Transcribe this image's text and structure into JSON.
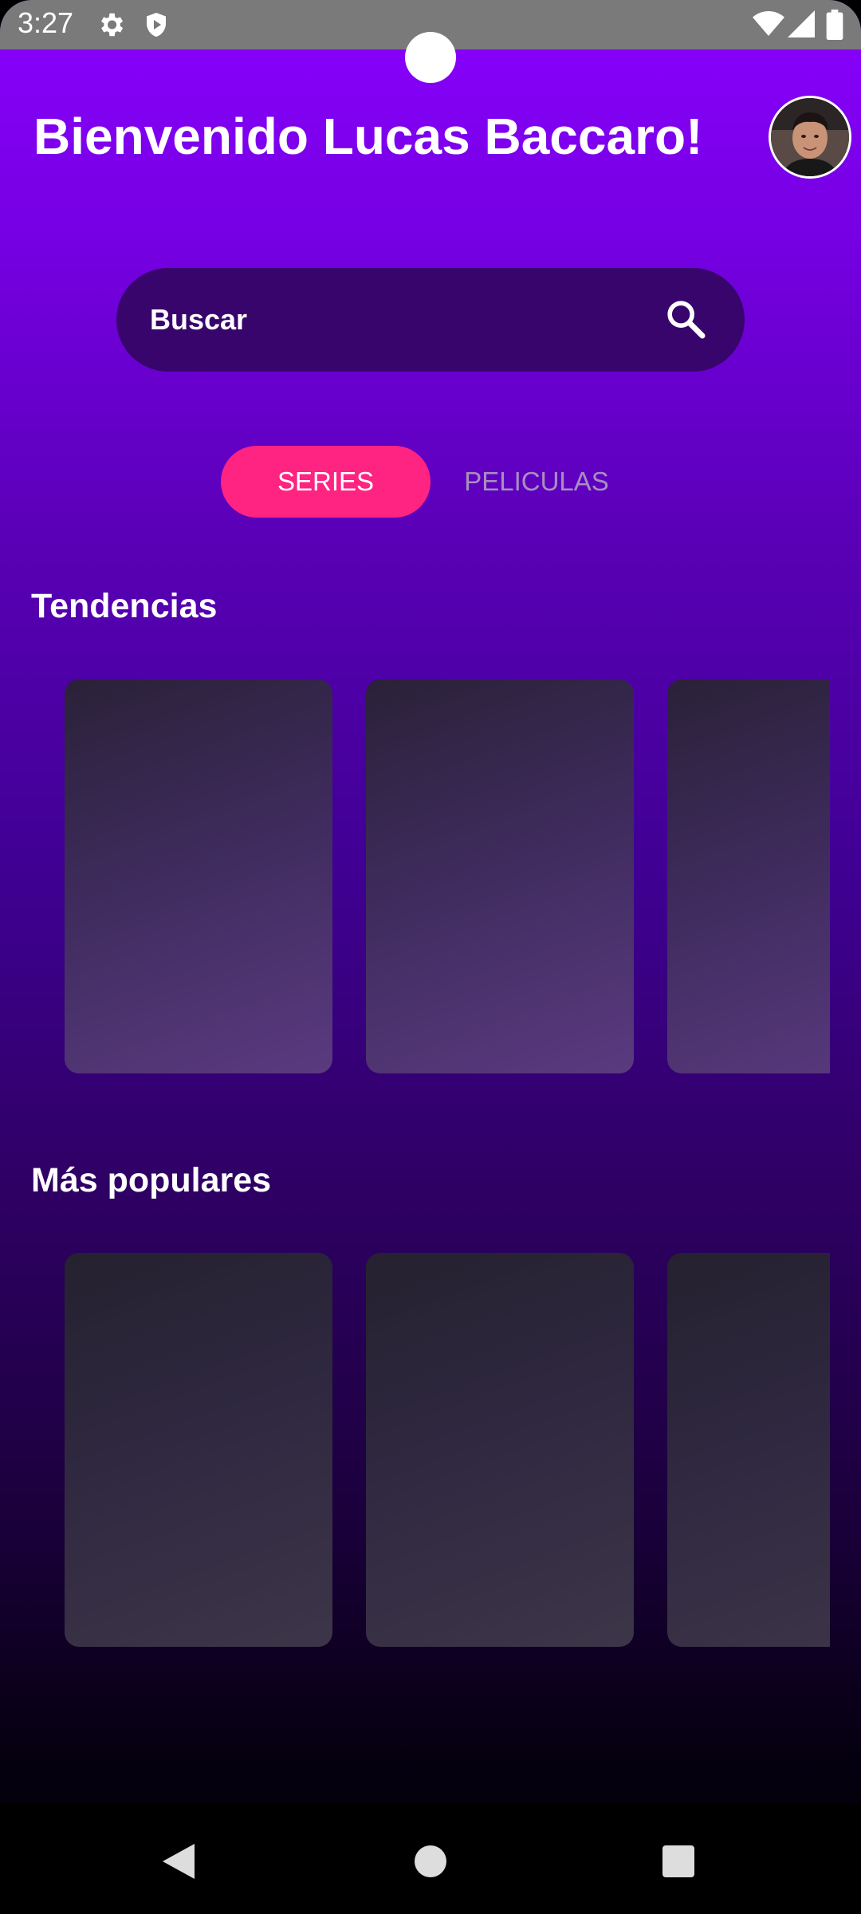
{
  "status_bar": {
    "time": "3:27",
    "icons": [
      "gear-icon",
      "shield-icon",
      "wifi-icon",
      "signal-icon",
      "battery-icon"
    ]
  },
  "header": {
    "greeting": "Bienvenido Lucas Baccaro!",
    "avatar": "profile-photo"
  },
  "search": {
    "placeholder": "Buscar",
    "icon": "search-icon"
  },
  "tabs": [
    {
      "label": "SERIES",
      "selected": true
    },
    {
      "label": "PELICULAS",
      "selected": false
    }
  ],
  "sections": {
    "trending": {
      "title": "Tendencias",
      "cards": 3
    },
    "popular": {
      "title": "Más populares",
      "cards": 3
    }
  },
  "nav_bar": {
    "buttons": [
      "back-icon",
      "home-icon",
      "recents-icon"
    ]
  },
  "colors": {
    "accent": "#ff2382",
    "gradient_top": "#8a00fe",
    "gradient_bottom": "#000000",
    "search_bg": "#37056b",
    "tab_inactive_text": "#a78fbf"
  }
}
